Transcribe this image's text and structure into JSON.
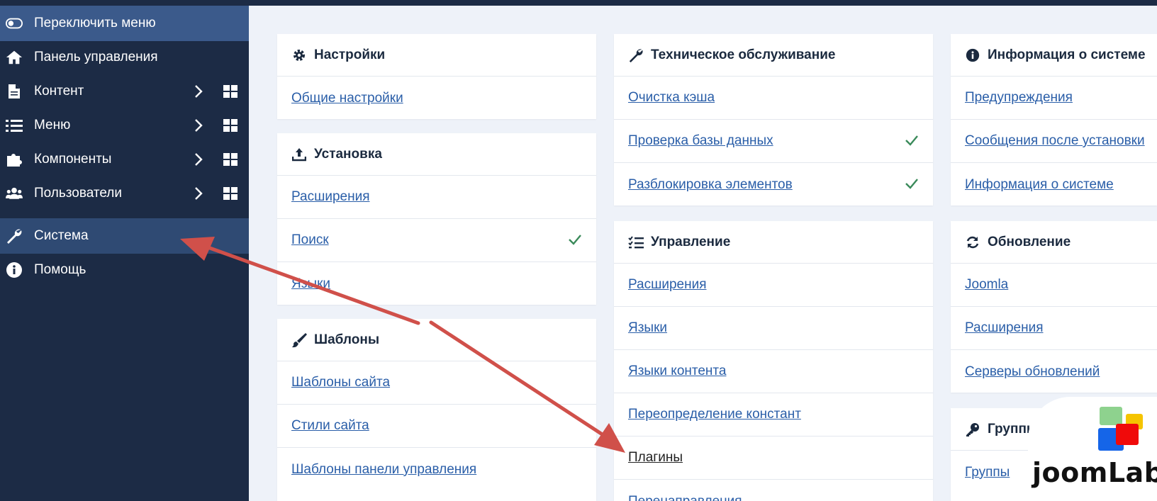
{
  "sidebar": {
    "toggle_label": "Переключить меню",
    "items": [
      {
        "label": "Панель управления"
      },
      {
        "label": "Контент"
      },
      {
        "label": "Меню"
      },
      {
        "label": "Компоненты"
      },
      {
        "label": "Пользователи"
      },
      {
        "label": "Система"
      },
      {
        "label": "Помощь"
      }
    ]
  },
  "cards": {
    "settings": {
      "title": "Настройки",
      "links": [
        "Общие настройки"
      ]
    },
    "install": {
      "title": "Установка",
      "links": [
        "Расширения",
        "Поиск",
        "Языки"
      ]
    },
    "templates": {
      "title": "Шаблоны",
      "links": [
        "Шаблоны сайта",
        "Стили сайта",
        "Шаблоны панели управления"
      ]
    },
    "maintenance": {
      "title": "Техническое обслуживание",
      "links": [
        "Очистка кэша",
        "Проверка базы данных",
        "Разблокировка элементов"
      ]
    },
    "manage": {
      "title": "Управление",
      "links": [
        "Расширения",
        "Языки",
        "Языки контента",
        "Переопределение констант",
        "Плагины",
        "Перенаправления"
      ]
    },
    "sysinfo": {
      "title": "Информация о системе",
      "links": [
        "Предупреждения",
        "Сообщения после установки",
        "Информация о системе"
      ]
    },
    "update": {
      "title": "Обновление",
      "links": [
        "Joomla",
        "Расширения",
        "Серверы обновлений"
      ]
    },
    "groups": {
      "title": "Группы и",
      "links": [
        "Группы"
      ]
    }
  },
  "watermark": {
    "text": "joomLab"
  },
  "colors": {
    "sidebar": "#1c2b45",
    "toggle": "#3b5a8b",
    "active": "#2f4a73",
    "link": "#2a5ea8",
    "check": "#3a8a5a",
    "arrow": "#d0504a"
  }
}
